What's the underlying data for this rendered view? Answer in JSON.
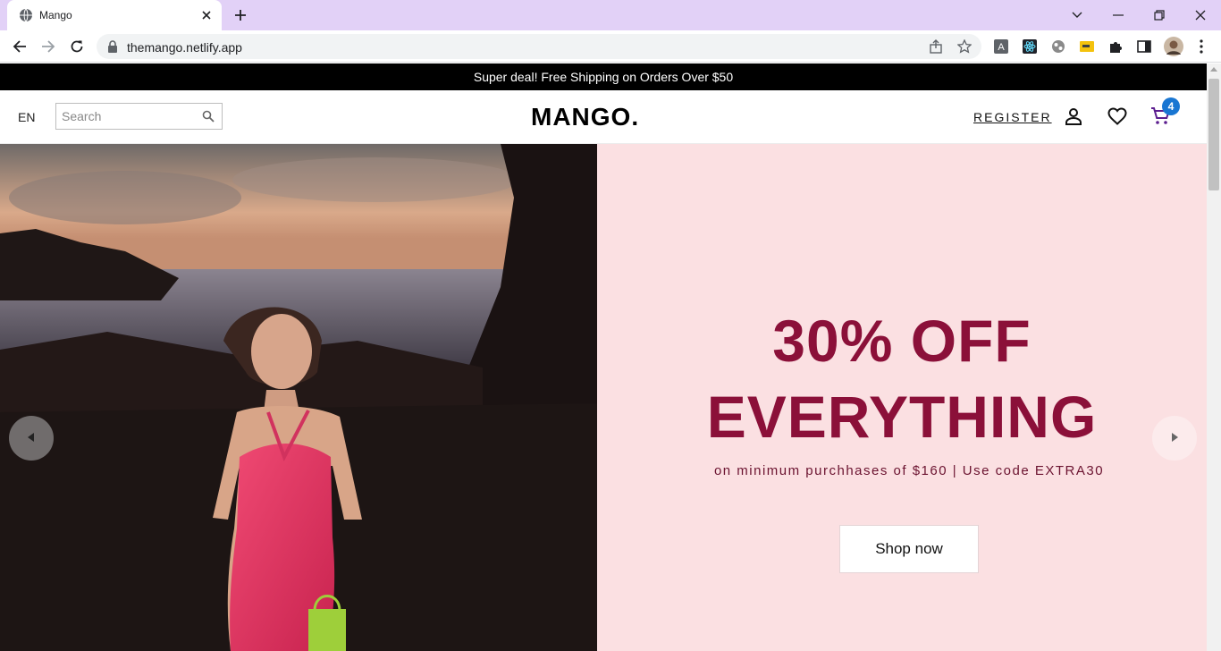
{
  "browser": {
    "tab_title": "Mango",
    "url": "themango.netlify.app"
  },
  "promo": {
    "text": "Super deal! Free Shipping on Orders Over $50"
  },
  "header": {
    "language": "EN",
    "search_placeholder": "Search",
    "logo": "MANGO.",
    "register_label": "REGISTER",
    "cart_count": "4"
  },
  "hero": {
    "headline_line1": "30% OFF",
    "headline_line2": "EVERYTHING",
    "subline": "on minimum purchhases of $160 | Use code EXTRA30",
    "cta_label": "Shop now"
  },
  "colors": {
    "headline": "#8b1039",
    "hero_panel": "#fbe0e2",
    "promo_bar": "#000000",
    "cart_badge": "#1976d2",
    "tab_strip": "#e2d1f7"
  },
  "icons": [
    "globe-icon",
    "close-icon",
    "plus-icon",
    "chevron-down-icon",
    "minimize-icon",
    "restore-icon",
    "back-icon",
    "forward-icon",
    "reload-icon",
    "lock-icon",
    "share-icon",
    "star-icon",
    "puzzle-icon",
    "sidepanel-icon",
    "avatar",
    "more-vert-icon",
    "search-icon",
    "user-icon",
    "heart-icon",
    "cart-icon",
    "chevron-left-icon",
    "chevron-right-icon"
  ]
}
